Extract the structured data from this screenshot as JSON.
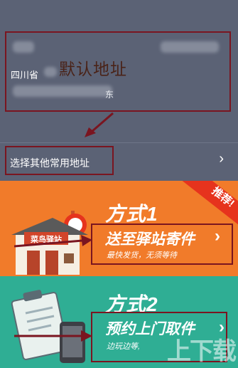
{
  "address": {
    "default_label": "默认地址",
    "province": "四川省",
    "address_suffix": "东"
  },
  "other_address": {
    "label": "选择其他常用地址",
    "chevron": "›"
  },
  "method1": {
    "badge": "推荐!",
    "title": "方式1",
    "action": "送至驿站寄件",
    "chevron": "›",
    "subtitle": "最快发货，无须等待",
    "station_sign": "菜鸟驿站"
  },
  "method2": {
    "title": "方式2",
    "action": "预约上门取件",
    "chevron": "›",
    "subtitle": "边玩边等,"
  },
  "watermark": "上下载",
  "colors": {
    "address_bg": "#5b6275",
    "annotation_red": "#7a1520",
    "method1_bg": "#f17b2a",
    "badge_red": "#e6331d",
    "method2_bg": "#2fae94"
  },
  "icons": [
    "house-station-icon",
    "clipboard-phone-icon",
    "chevron-right-icon"
  ]
}
